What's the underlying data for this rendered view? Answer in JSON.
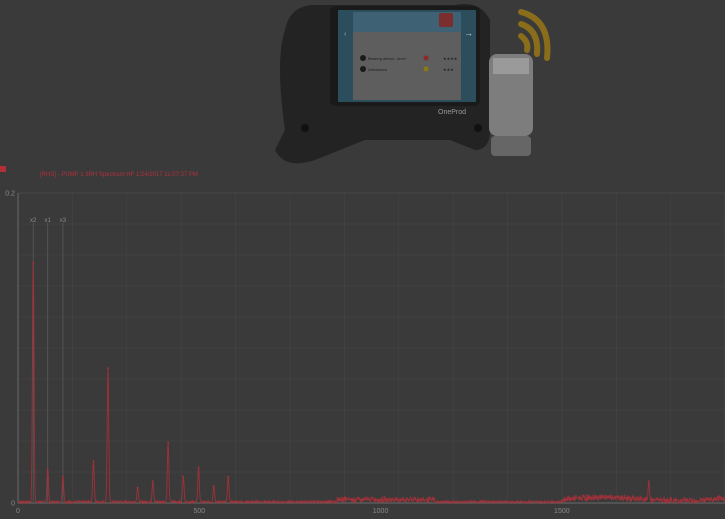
{
  "device": {
    "brand_label": "OneProd",
    "icon_names": [
      "wifi-signal-icon",
      "wireless-sensor-icon",
      "back-arrow-icon",
      "forward-arrow-icon",
      "alert-icon"
    ],
    "screen_rows": [
      {
        "label": "Bearing defect - level",
        "color": "#c0392b",
        "stars": "★★★★"
      },
      {
        "label": "Unbalance",
        "color": "#e6b800",
        "stars": "★★★"
      }
    ]
  },
  "chart_data": {
    "type": "line",
    "title": "[RHS] - PUMP 1 3RH Spectrum HF 1/24/2017 11:07:37 PM",
    "series_color": "#b0303a",
    "xlim": [
      0,
      1950
    ],
    "ylim": [
      0,
      0.2
    ],
    "x_ticks": [
      0,
      500,
      1000,
      1500
    ],
    "y_ticks": [
      0,
      0.2
    ],
    "y_tick_labels": [
      "0",
      "0.2"
    ],
    "grid": true,
    "legend": "top-left",
    "markers": [
      {
        "label": "x2",
        "x": 42
      },
      {
        "label": "x1",
        "x": 82
      },
      {
        "label": "x3",
        "x": 124
      }
    ],
    "peaks": [
      {
        "x": 42,
        "y": 0.155
      },
      {
        "x": 82,
        "y": 0.022
      },
      {
        "x": 124,
        "y": 0.017
      },
      {
        "x": 208,
        "y": 0.027
      },
      {
        "x": 248,
        "y": 0.087
      },
      {
        "x": 330,
        "y": 0.01
      },
      {
        "x": 372,
        "y": 0.014
      },
      {
        "x": 414,
        "y": 0.039
      },
      {
        "x": 456,
        "y": 0.017
      },
      {
        "x": 498,
        "y": 0.023
      },
      {
        "x": 540,
        "y": 0.011
      },
      {
        "x": 580,
        "y": 0.017
      },
      {
        "x": 1740,
        "y": 0.014
      }
    ]
  }
}
